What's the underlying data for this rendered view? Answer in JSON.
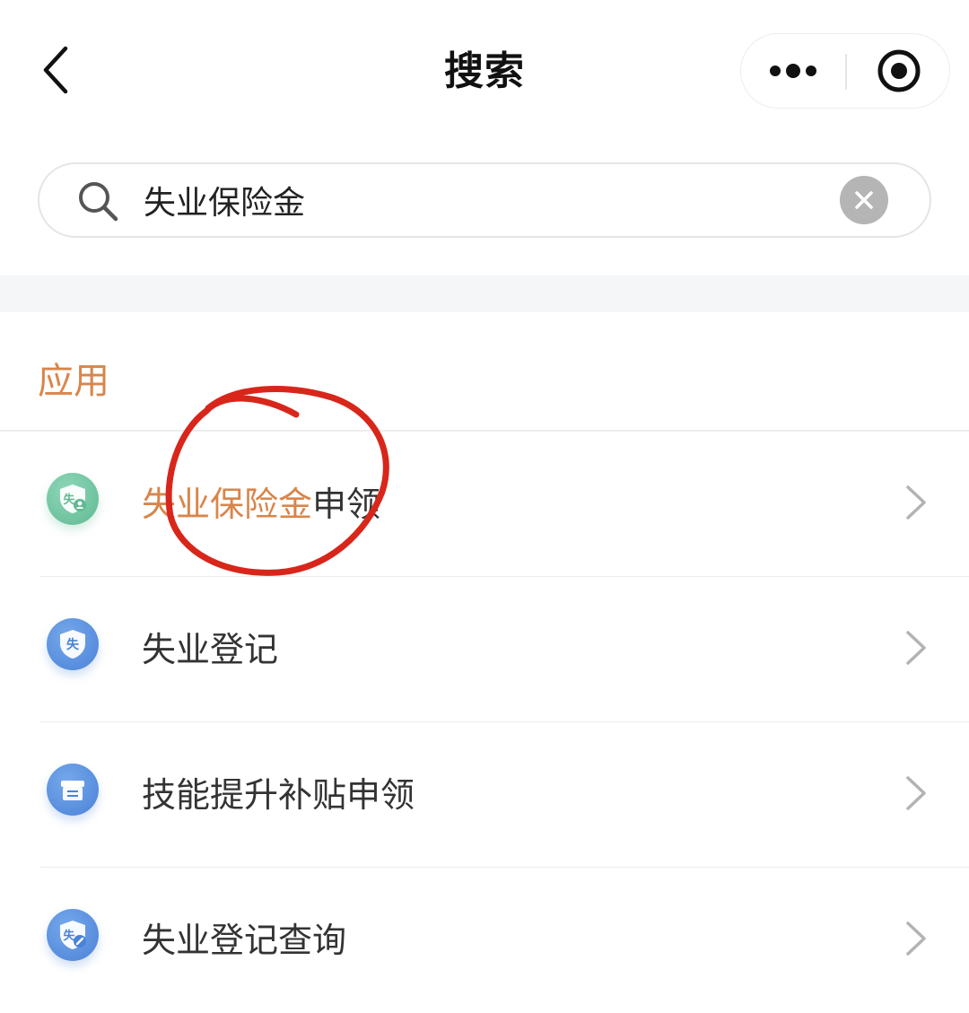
{
  "nav": {
    "title": "搜索",
    "back_icon": "chevron-left-icon",
    "more_icon": "more-dots-icon",
    "close_icon": "target-circle-icon"
  },
  "search": {
    "value": "失业保险金",
    "search_icon": "search-icon",
    "clear_icon": "clear-x-icon"
  },
  "section": {
    "title": "应用"
  },
  "list": {
    "items": [
      {
        "highlight": "失业保险金",
        "rest": "申领",
        "icon": "unemployment-insurance-icon",
        "icon_color": "#5fb992",
        "icon_text": "失"
      },
      {
        "highlight": "",
        "rest": "失业登记",
        "icon": "unemployment-shield-icon",
        "icon_color": "#4a82d8",
        "icon_text": "失"
      },
      {
        "highlight": "",
        "rest": "技能提升补贴申领",
        "icon": "skill-subsidy-icon",
        "icon_color": "#4a82d8"
      },
      {
        "highlight": "",
        "rest": "失业登记查询",
        "icon": "unemployment-query-icon",
        "icon_color": "#4a82d8",
        "icon_text": "失"
      }
    ]
  },
  "colors": {
    "accent": "#d9854a",
    "annotation_circle": "#d8261b"
  }
}
